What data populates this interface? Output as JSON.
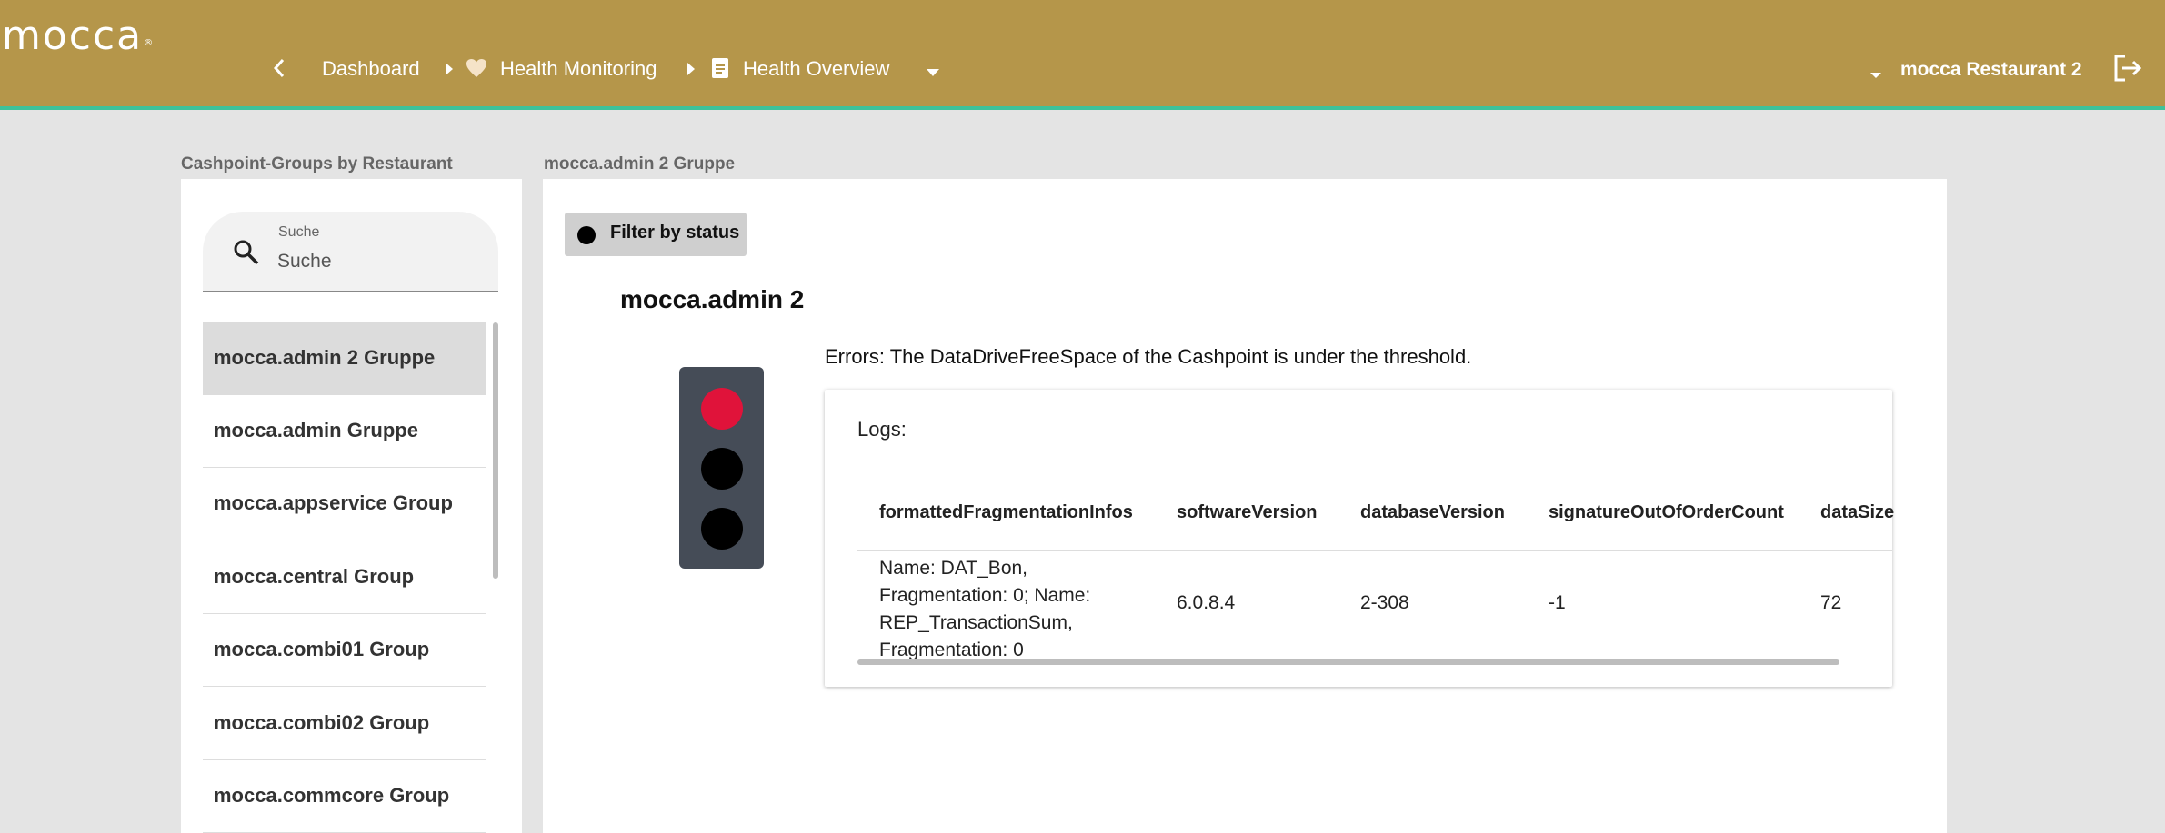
{
  "header": {
    "logo": "mocca",
    "logo_mark": "®",
    "breadcrumb": {
      "dashboard": "Dashboard",
      "health_monitoring": "Health Monitoring",
      "health_overview": "Health Overview"
    },
    "restaurant": "mocca Restaurant 2",
    "icons": [
      "chevron-left-icon",
      "caret-right-icon",
      "heart-icon",
      "document-icon",
      "caret-down-icon",
      "logout-icon"
    ],
    "colors": {
      "bar": "#b5964a",
      "accent_line": "#3ec29a"
    }
  },
  "sidebar": {
    "title": "Cashpoint-Groups by Restaurant",
    "search": {
      "label": "Suche",
      "placeholder": "Suche"
    },
    "items": [
      {
        "label": "mocca.admin 2 Gruppe",
        "active": true
      },
      {
        "label": "mocca.admin Gruppe"
      },
      {
        "label": "mocca.appservice Group"
      },
      {
        "label": "mocca.central Group"
      },
      {
        "label": "mocca.combi01 Group"
      },
      {
        "label": "mocca.combi02 Group"
      },
      {
        "label": "mocca.commcore Group"
      }
    ]
  },
  "main": {
    "title": "mocca.admin 2 Gruppe",
    "filter_label": "Filter by status",
    "cashpoint": {
      "name": "mocca.admin 2",
      "status": "error",
      "status_colors": {
        "red": "#e0133a",
        "off": "#000000"
      },
      "error_text": "Errors: The DataDriveFreeSpace of the Cashpoint is under the threshold."
    },
    "logs": {
      "title": "Logs:",
      "columns": [
        "formattedFragmentationInfos",
        "softwareVersion",
        "databaseVersion",
        "signatureOutOfOrderCount",
        "dataSize"
      ],
      "rows": [
        {
          "fragmentation_lines": [
            "Name: DAT_Bon,",
            "Fragmentation: 0; Name:",
            "REP_TransactionSum,",
            "Fragmentation: 0"
          ],
          "softwareVersion": "6.0.8.4",
          "databaseVersion": "2-308",
          "signatureOutOfOrderCount": "-1",
          "dataSize": "72"
        }
      ]
    }
  }
}
